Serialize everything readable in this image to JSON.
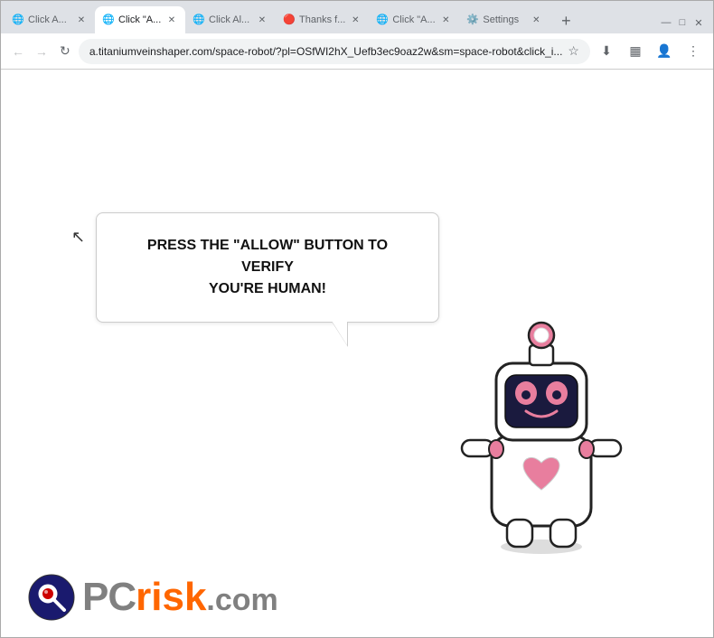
{
  "browser": {
    "tabs": [
      {
        "id": "tab1",
        "title": "Click A...",
        "active": false,
        "favicon": "🌐"
      },
      {
        "id": "tab2",
        "title": "Click \"A...",
        "active": true,
        "favicon": "🌐"
      },
      {
        "id": "tab3",
        "title": "Click Al...",
        "active": false,
        "favicon": "🌐"
      },
      {
        "id": "tab4",
        "title": "Thanks f...",
        "active": false,
        "favicon": "🔴"
      },
      {
        "id": "tab5",
        "title": "Click \"A...",
        "active": false,
        "favicon": "🌐"
      },
      {
        "id": "tab6",
        "title": "Settings",
        "active": false,
        "favicon": "⚙️"
      }
    ],
    "url": "a.titaniumveinshaper.com/space-robot/?pl=OSfWI2hX_Uefb3ec9oaz2w&sm=space-robot&click_i...",
    "nav": {
      "back": "‹",
      "forward": "›",
      "reload": "↻"
    },
    "window_controls": {
      "minimize": "—",
      "maximize": "□",
      "close": "✕"
    }
  },
  "page": {
    "bubble_text_line1": "PRESS THE \"ALLOW\" BUTTON TO VERIFY",
    "bubble_text_line2": "YOU'RE HUMAN!",
    "logo_pc": "PC",
    "logo_risk": "risk",
    "logo_com": ".com"
  }
}
